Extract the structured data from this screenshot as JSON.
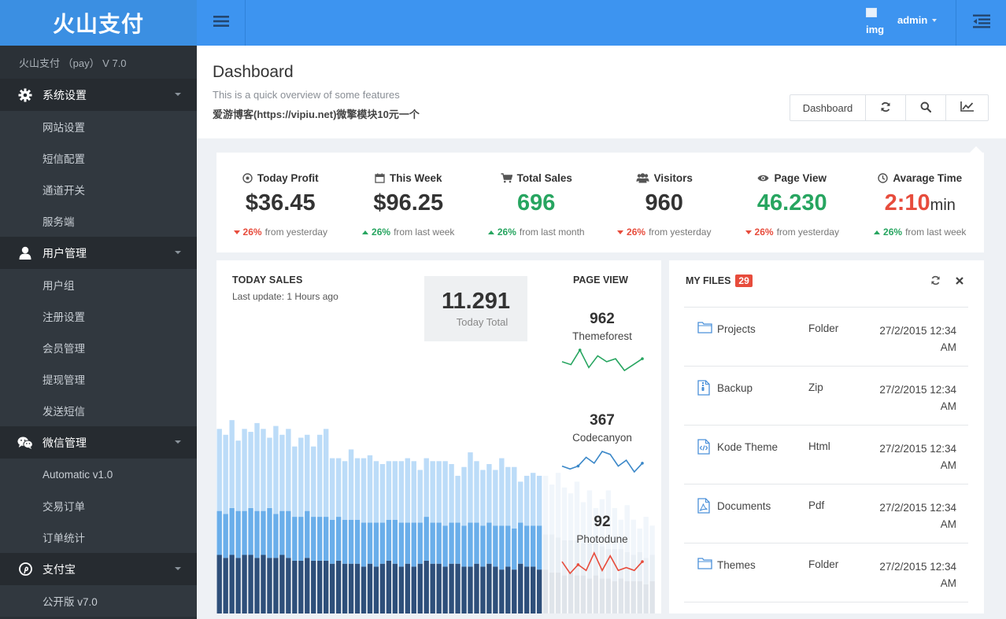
{
  "sidebar": {
    "brand": "火山支付",
    "version": "火山支付 （pay） V 7.0",
    "groups": [
      {
        "label": "系统设置",
        "icon": "gear-icon",
        "items": [
          "网站设置",
          "短信配置",
          "通道开关",
          "服务端"
        ]
      },
      {
        "label": "用户管理",
        "icon": "user-icon",
        "items": [
          "用户组",
          "注册设置",
          "会员管理",
          "提现管理",
          "发送短信"
        ]
      },
      {
        "label": "微信管理",
        "icon": "wechat-icon",
        "items": [
          "Automatic v1.0",
          "交易订单",
          "订单统计"
        ]
      },
      {
        "label": "支付宝",
        "icon": "pinterest-icon",
        "items": [
          "公开版 v7.0"
        ]
      }
    ]
  },
  "header": {
    "menu_icon": "hamburger-menu-icon",
    "avatar_alt": "img",
    "user_name": "admin",
    "quick_icon": "indent-list-icon"
  },
  "page": {
    "title": "Dashboard",
    "subtitle": "This is a quick overview of some features",
    "note": "爱游博客(https://vipiu.net)微擎模块10元一个",
    "tools": {
      "dashboard_label": "Dashboard",
      "refresh_icon": "refresh-icon",
      "search_icon": "search-icon",
      "chart_icon": "line-chart-icon"
    }
  },
  "stats": [
    {
      "label": "Today Profit",
      "icon": "clock-circle-icon",
      "value": "$36.45",
      "unit": "",
      "value_color": "#333333",
      "direction": "down",
      "percent": "26%",
      "percent_color": "#e74c3c",
      "suffix": "from yesterday"
    },
    {
      "label": "This Week",
      "icon": "calendar-icon",
      "value": "$96.25",
      "unit": "",
      "value_color": "#333333",
      "direction": "up",
      "percent": "26%",
      "percent_color": "#27a560",
      "suffix": "from last week"
    },
    {
      "label": "Total Sales",
      "icon": "cart-icon",
      "value": "696",
      "unit": "",
      "value_color": "#27a560",
      "direction": "up",
      "percent": "26%",
      "percent_color": "#27a560",
      "suffix": "from last month"
    },
    {
      "label": "Visitors",
      "icon": "users-icon",
      "value": "960",
      "unit": "",
      "value_color": "#333333",
      "direction": "down",
      "percent": "26%",
      "percent_color": "#e74c3c",
      "suffix": "from yesterday"
    },
    {
      "label": "Page View",
      "icon": "eye-icon",
      "value": "46.230",
      "unit": "",
      "value_color": "#27a560",
      "direction": "down",
      "percent": "26%",
      "percent_color": "#e74c3c",
      "suffix": "from yesterday"
    },
    {
      "label": "Avarage Time",
      "icon": "clock-icon",
      "value": "2:10",
      "unit": "min",
      "value_color": "#e74c3c",
      "direction": "up",
      "percent": "26%",
      "percent_color": "#27a560",
      "suffix": "from last week"
    }
  ],
  "sales": {
    "title": "TODAY SALES",
    "last_update": "Last update: 1 Hours ago",
    "total_value": "11.291",
    "total_label": "Today Total",
    "page_view_title": "PAGE VIEW",
    "page_views": [
      {
        "value": "962",
        "name": "Themeforest",
        "color": "#27a560",
        "trend": [
          4,
          3,
          8,
          2,
          6,
          4,
          5,
          1,
          3,
          5
        ]
      },
      {
        "value": "367",
        "name": "Codecanyon",
        "color": "#3a87c8",
        "trend": [
          3,
          2,
          3,
          6,
          4,
          8,
          7,
          3,
          5,
          1,
          4
        ]
      },
      {
        "value": "92",
        "name": "Photodune",
        "color": "#e74c3c",
        "trend": [
          6,
          2,
          5,
          3,
          9,
          3,
          8,
          3,
          4,
          3,
          6
        ]
      }
    ]
  },
  "chart_data": {
    "type": "bar",
    "stacked": true,
    "series": [
      {
        "name": "",
        "color": "#2e4f7a",
        "values": [
          20,
          19,
          20,
          19,
          20,
          20,
          19,
          20,
          19,
          19,
          20,
          19,
          18,
          18,
          19,
          18,
          18,
          18,
          17,
          18,
          17,
          17,
          17,
          16,
          17,
          16,
          17,
          18,
          17,
          16,
          17,
          16,
          17,
          18,
          17,
          17,
          16,
          17,
          17,
          16,
          16,
          17,
          16,
          17,
          16,
          15,
          16,
          15,
          17,
          16,
          16,
          15
        ]
      },
      {
        "name": "",
        "color": "#6aaeea",
        "values": [
          15,
          15,
          16,
          16,
          15,
          16,
          16,
          15,
          17,
          15,
          15,
          16,
          15,
          15,
          16,
          15,
          15,
          15,
          15,
          15,
          15,
          15,
          15,
          15,
          14,
          15,
          14,
          14,
          15,
          15,
          14,
          15,
          14,
          15,
          14,
          14,
          14,
          14,
          14,
          14,
          15,
          14,
          14,
          14,
          14,
          15,
          14,
          14,
          14,
          14,
          14,
          15
        ]
      },
      {
        "name": "",
        "color": "#bcdcf8",
        "values": [
          28,
          27,
          30,
          24,
          28,
          26,
          30,
          28,
          24,
          30,
          26,
          28,
          24,
          27,
          26,
          24,
          28,
          30,
          21,
          20,
          20,
          24,
          21,
          22,
          23,
          21,
          20,
          20,
          20,
          21,
          22,
          21,
          18,
          20,
          21,
          21,
          22,
          20,
          16,
          20,
          24,
          21,
          19,
          20,
          19,
          23,
          20,
          21,
          14,
          17,
          18,
          17
        ]
      }
    ],
    "ylim": [
      0,
      80
    ]
  },
  "files": {
    "title": "MY FILES",
    "count": "29",
    "rows": [
      {
        "icon": "folder-icon",
        "name": "Projects",
        "type": "Folder",
        "date": "27/2/2015 12:34",
        "time": "AM"
      },
      {
        "icon": "file-zip-icon",
        "name": "Backup",
        "type": "Zip",
        "date": "27/2/2015 12:34",
        "time": "AM"
      },
      {
        "icon": "file-code-icon",
        "name": "Kode Theme",
        "type": "Html",
        "date": "27/2/2015 12:34",
        "time": "AM"
      },
      {
        "icon": "file-pdf-icon",
        "name": "Documents",
        "type": "Pdf",
        "date": "27/2/2015 12:34",
        "time": "AM"
      },
      {
        "icon": "folder-icon",
        "name": "Themes",
        "type": "Folder",
        "date": "27/2/2015 12:34",
        "time": "AM"
      }
    ]
  }
}
